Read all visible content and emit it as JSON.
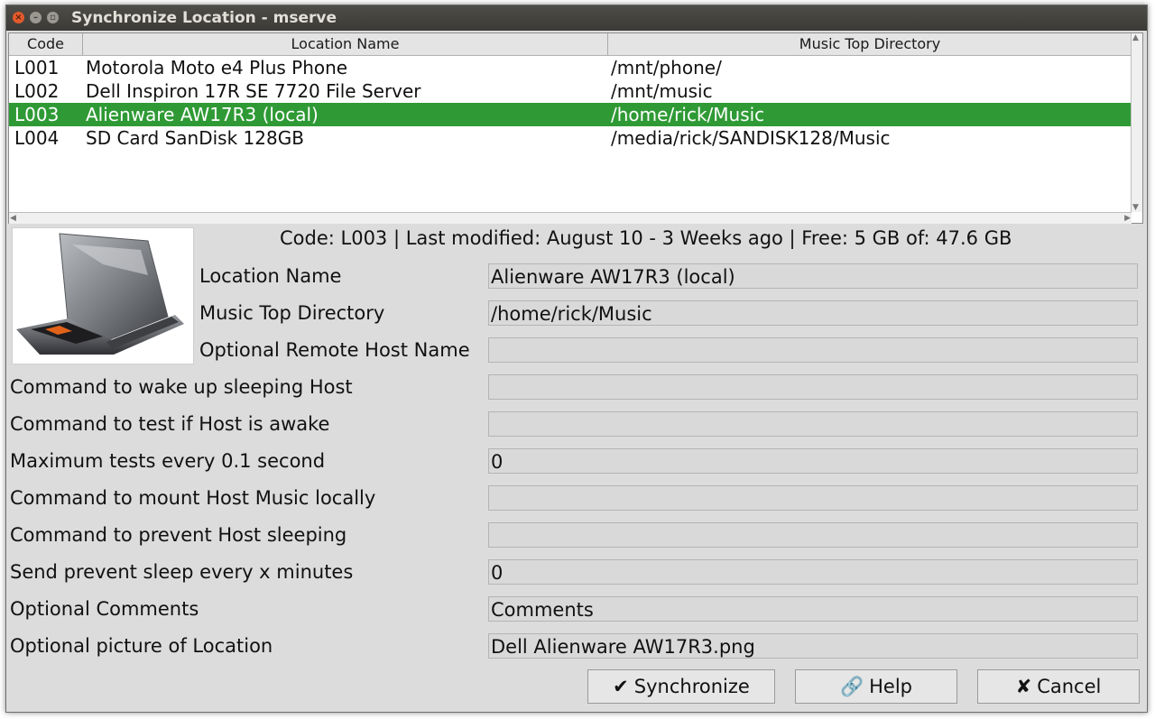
{
  "window": {
    "title": "Synchronize Location - mserve",
    "close_glyph": "×",
    "min_glyph": "–",
    "max_glyph": "▫"
  },
  "table": {
    "columns": [
      "Code",
      "Location Name",
      "Music Top Directory"
    ],
    "rows": [
      {
        "code": "L001",
        "name": "Motorola Moto e4 Plus Phone",
        "dir": "/mnt/phone/"
      },
      {
        "code": "L002",
        "name": "Dell Inspiron 17R SE 7720 File Server",
        "dir": "/mnt/music"
      },
      {
        "code": "L003",
        "name": "Alienware AW17R3 (local)",
        "dir": "/home/rick/Music"
      },
      {
        "code": "L004",
        "name": "SD Card SanDisk 128GB",
        "dir": "/media/rick/SANDISK128/Music"
      }
    ],
    "selected_code": "L003"
  },
  "details": {
    "info_line": "Code: L003  | Last modified: August 10 - 3 Weeks ago  | Free: 5 GB of: 47.6 GB",
    "fields": [
      {
        "label": "Location Name",
        "value": "Alienware AW17R3 (local)"
      },
      {
        "label": "Music Top Directory",
        "value": "/home/rick/Music"
      },
      {
        "label": "Optional Remote Host Name",
        "value": ""
      },
      {
        "label": "Command to wake up sleeping Host",
        "value": ""
      },
      {
        "label": "Command to test if Host is awake",
        "value": ""
      },
      {
        "label": "Maximum tests every 0.1 second",
        "value": "0"
      },
      {
        "label": "Command to mount Host Music locally",
        "value": ""
      },
      {
        "label": "Command to prevent Host sleeping",
        "value": ""
      },
      {
        "label": "Send prevent sleep every x minutes",
        "value": "0"
      },
      {
        "label": "Optional Comments",
        "value": "Comments"
      },
      {
        "label": "Optional picture of Location",
        "value": "Dell Alienware AW17R3.png"
      }
    ]
  },
  "buttons": {
    "synchronize": {
      "icon": "✔",
      "label": "Synchronize"
    },
    "help": {
      "icon": "🔗",
      "label": "Help"
    },
    "cancel": {
      "icon": "✘",
      "label": "Cancel"
    }
  },
  "colors": {
    "selection": "#2f9a35",
    "window_bg": "#dcdcdc",
    "titlebar": "#3b3a36"
  }
}
